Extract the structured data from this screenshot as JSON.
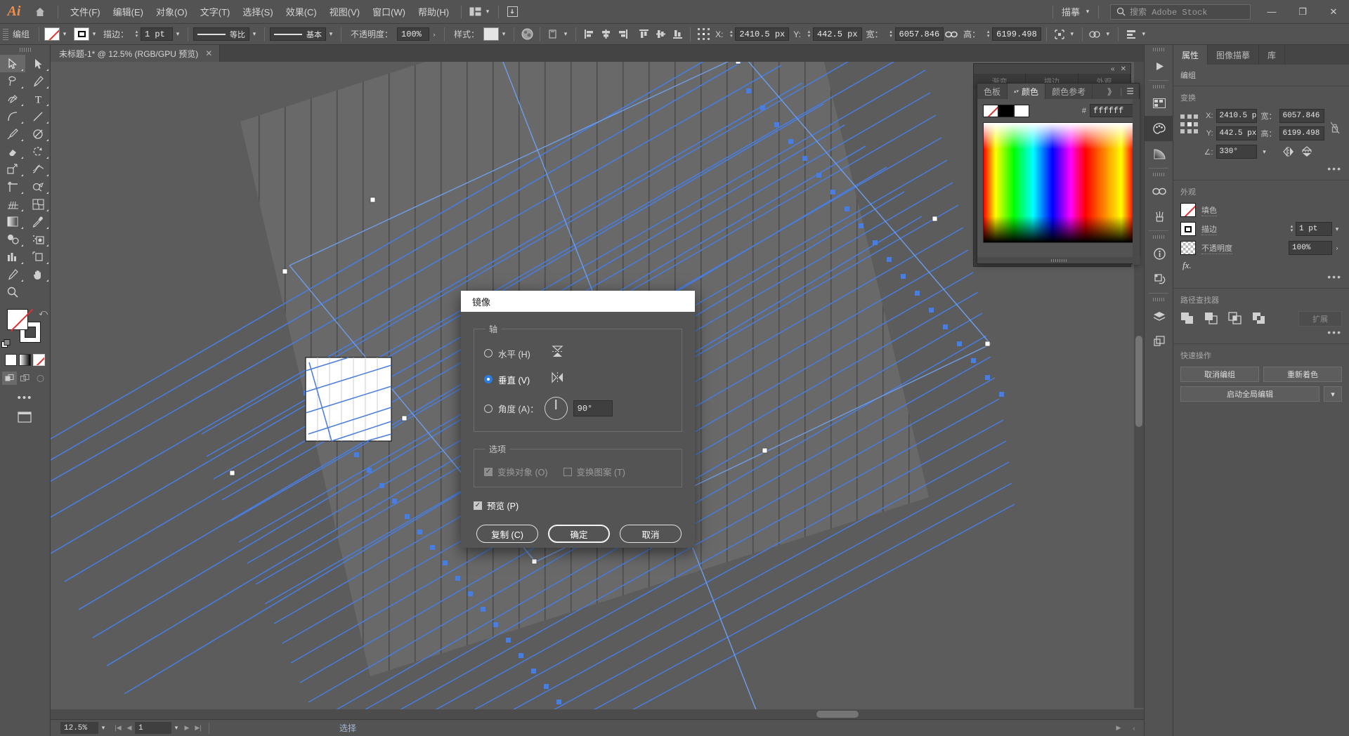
{
  "menubar": {
    "app_logo": "Ai",
    "items": [
      {
        "label": "文件(F)"
      },
      {
        "label": "编辑(E)"
      },
      {
        "label": "对象(O)"
      },
      {
        "label": "文字(T)"
      },
      {
        "label": "选择(S)"
      },
      {
        "label": "效果(C)"
      },
      {
        "label": "视图(V)"
      },
      {
        "label": "窗口(W)"
      },
      {
        "label": "帮助(H)"
      }
    ],
    "workspace": "描摹",
    "search_placeholder": "搜索 Adobe Stock",
    "window_minimize": "—",
    "window_restore": "❐",
    "window_close": "✕"
  },
  "controlbar": {
    "selection_label": "编组",
    "stroke_label": "描边：",
    "stroke_weight": "1 pt",
    "profile_label": "等比",
    "brush_label": "基本",
    "opacity_label": "不透明度：",
    "opacity_value": "100%",
    "style_label": "样式：",
    "x_label": "X:",
    "x_value": "2410.5 px",
    "y_label": "Y:",
    "y_value": "442.5 px",
    "w_label": "宽：",
    "w_value": "6057.846",
    "h_label": "高：",
    "h_value": "6199.498"
  },
  "doctab": {
    "title": "未标题-1* @ 12.5% (RGB/GPU 预览)",
    "close": "✕"
  },
  "toolbar": {
    "tools": [
      {
        "name": "selection-tool",
        "glyph": "➤"
      },
      {
        "name": "direct-selection-tool",
        "glyph": "➤"
      },
      {
        "name": "lasso-tool",
        "glyph": "❀"
      },
      {
        "name": "pen-tool",
        "glyph": "✒"
      },
      {
        "name": "curvature-tool",
        "glyph": "✐"
      },
      {
        "name": "type-tool",
        "glyph": "T"
      },
      {
        "name": "arc-tool",
        "glyph": "◜"
      },
      {
        "name": "line-segment-tool",
        "glyph": "╱"
      },
      {
        "name": "paintbrush-tool",
        "glyph": "🖌"
      },
      {
        "name": "shaper-tool",
        "glyph": "◑"
      },
      {
        "name": "eraser-tool",
        "glyph": "◆"
      },
      {
        "name": "rotate-tool",
        "glyph": "↻"
      },
      {
        "name": "scale-tool",
        "glyph": "⬈"
      },
      {
        "name": "width-tool",
        "glyph": "≋"
      },
      {
        "name": "free-transform-tool",
        "glyph": "✛"
      },
      {
        "name": "shape-builder-tool",
        "glyph": "◕"
      },
      {
        "name": "perspective-grid-tool",
        "glyph": "▦"
      },
      {
        "name": "mesh-tool",
        "glyph": "⊞"
      },
      {
        "name": "gradient-tool",
        "glyph": "▤"
      },
      {
        "name": "eyedropper-tool",
        "glyph": "⚲"
      },
      {
        "name": "blend-tool",
        "glyph": "◍"
      },
      {
        "name": "symbol-sprayer-tool",
        "glyph": "⊡"
      },
      {
        "name": "column-graph-tool",
        "glyph": "▥"
      },
      {
        "name": "artboard-tool",
        "glyph": "⊐"
      },
      {
        "name": "slice-tool",
        "glyph": "✎"
      },
      {
        "name": "hand-tool",
        "glyph": "✋"
      },
      {
        "name": "zoom-tool",
        "glyph": "🔍"
      }
    ],
    "more_label": "•••"
  },
  "canvas": {
    "zoom": "12.5%",
    "artwork_description": "rotated blue hatch grid artwork with selection bounding box"
  },
  "statusbar": {
    "zoom_value": "12.5%",
    "page_value": "1",
    "status_text": "选择",
    "first_label": "|◀",
    "prev_label": "◀",
    "next_label": "▶",
    "last_label": "▶|"
  },
  "color_panel": {
    "tabs": [
      {
        "label": "色板",
        "active": false
      },
      {
        "label": "颜色",
        "active": true
      },
      {
        "label": "颜色参考",
        "active": false
      }
    ],
    "overflow": "》",
    "menu": "☰",
    "hash_label": "#",
    "hex_value": "ffffff",
    "swatches": [
      "none",
      "black",
      "white"
    ]
  },
  "behind_panel": {
    "tabs": [
      "渐变",
      "描边",
      "外观"
    ],
    "collapse": "«",
    "close": "✕"
  },
  "right_rail": {
    "buttons": [
      {
        "name": "play-icon",
        "glyph": "▶",
        "active": false
      },
      {
        "name": "swatches-icon",
        "glyph": "▦",
        "active": false
      },
      {
        "name": "color-icon",
        "glyph": "◕",
        "active": true
      },
      {
        "name": "gradient-icon",
        "glyph": "◱",
        "active": false
      },
      {
        "name": "links-icon",
        "glyph": "∞",
        "active": false
      },
      {
        "name": "brushes-icon",
        "glyph": "⑂",
        "active": false
      },
      {
        "name": "info-icon",
        "glyph": "ⓘ",
        "active": false
      },
      {
        "name": "transform-icon",
        "glyph": "⟲",
        "active": false
      },
      {
        "name": "layers-icon",
        "glyph": "◆",
        "active": false
      },
      {
        "name": "artboards-icon",
        "glyph": "▣",
        "active": false
      }
    ]
  },
  "properties": {
    "tabs": [
      {
        "label": "属性",
        "active": true
      },
      {
        "label": "图像描摹",
        "active": false
      },
      {
        "label": "库",
        "active": false
      }
    ],
    "object_type": "编组",
    "transform": {
      "title": "变换",
      "x_label": "X:",
      "x_value": "2410.5 p",
      "y_label": "Y:",
      "y_value": "442.5 px",
      "w_label": "宽：",
      "w_value": "6057.846",
      "h_label": "高：",
      "h_value": "6199.498",
      "angle_label": "∠:",
      "angle_value": "330°",
      "more": "•••"
    },
    "appearance": {
      "title": "外观",
      "fill_label": "填色",
      "stroke_label": "描边",
      "stroke_weight": "1 pt",
      "opacity_label": "不透明度",
      "opacity_value": "100%",
      "fx_label": "fx.",
      "more": "•••"
    },
    "pathfinder": {
      "title": "路径查找器",
      "expand_label": "扩展",
      "more": "•••"
    },
    "quick_actions": {
      "title": "快速操作",
      "ungroup_label": "取消编组",
      "recolor_label": "重新着色",
      "global_edit_label": "启动全局编辑"
    }
  },
  "dialog": {
    "title": "镜像",
    "axis": {
      "legend": "轴",
      "horizontal_label": "水平 (H)",
      "horizontal_selected": false,
      "vertical_label": "垂直 (V)",
      "vertical_selected": true,
      "angle_label": "角度 (A)：",
      "angle_selected": false,
      "angle_value": "90°"
    },
    "options": {
      "legend": "选项",
      "transform_objects_label": "变换对象 (O)",
      "transform_objects_checked": true,
      "transform_patterns_label": "变换图案 (T)",
      "transform_patterns_checked": false
    },
    "preview_label": "预览 (P)",
    "preview_checked": true,
    "buttons": {
      "copy": "复制 (C)",
      "ok": "确定",
      "cancel": "取消"
    }
  },
  "colors": {
    "chrome_bg": "#535353",
    "panel_bg": "#454545",
    "field_bg": "#3f3f3f",
    "canvas_bg": "#5c5c5c",
    "accent_blue": "#2a7ce0",
    "artwork_blue": "#4a7ddc",
    "text": "#d4d4d4",
    "dialog_bg": "#545454",
    "dialog_title_bg": "#ffffff",
    "status_text": "#9fb8d8"
  }
}
